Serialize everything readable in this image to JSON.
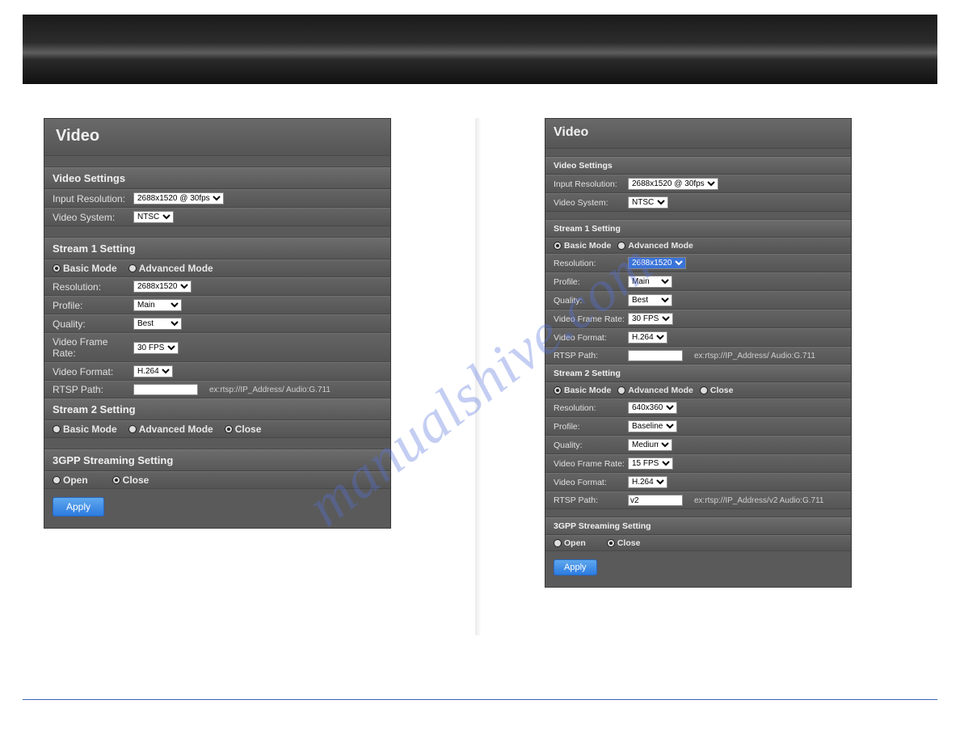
{
  "watermark": "manualshive.com",
  "left": {
    "title": "Video",
    "video_settings": {
      "header": "Video Settings",
      "input_res_label": "Input Resolution:",
      "input_res_value": "2688x1520 @ 30fps",
      "video_system_label": "Video System:",
      "video_system_value": "NTSC"
    },
    "stream1": {
      "header": "Stream 1 Setting",
      "mode_basic": "Basic Mode",
      "mode_advanced": "Advanced Mode",
      "resolution_label": "Resolution:",
      "resolution_value": "2688x1520",
      "profile_label": "Profile:",
      "profile_value": "Main",
      "quality_label": "Quality:",
      "quality_value": "Best",
      "fps_label": "Video Frame Rate:",
      "fps_value": "30 FPS",
      "format_label": "Video Format:",
      "format_value": "H.264",
      "rtsp_label": "RTSP Path:",
      "rtsp_value": "",
      "rtsp_hint": "ex:rtsp://IP_Address/   Audio:G.711"
    },
    "stream2": {
      "header": "Stream 2 Setting",
      "mode_basic": "Basic Mode",
      "mode_advanced": "Advanced Mode",
      "mode_close": "Close"
    },
    "gpp": {
      "header": "3GPP Streaming Setting",
      "open": "Open",
      "close": "Close"
    },
    "apply": "Apply"
  },
  "right": {
    "title": "Video",
    "video_settings": {
      "header": "Video Settings",
      "input_res_label": "Input Resolution:",
      "input_res_value": "2688x1520 @ 30fps",
      "video_system_label": "Video System:",
      "video_system_value": "NTSC"
    },
    "stream1": {
      "header": "Stream 1 Setting",
      "mode_basic": "Basic Mode",
      "mode_advanced": "Advanced Mode",
      "resolution_label": "Resolution:",
      "resolution_value": "2688x1520",
      "profile_label": "Profile:",
      "profile_value": "Main",
      "quality_label": "Quality:",
      "quality_value": "Best",
      "fps_label": "Video Frame Rate:",
      "fps_value": "30 FPS",
      "format_label": "Video Format:",
      "format_value": "H.264",
      "rtsp_label": "RTSP Path:",
      "rtsp_value": "",
      "rtsp_hint": "ex:rtsp://IP_Address/   Audio:G.711"
    },
    "stream2": {
      "header": "Stream 2 Setting",
      "mode_basic": "Basic Mode",
      "mode_advanced": "Advanced Mode",
      "mode_close": "Close",
      "resolution_label": "Resolution:",
      "resolution_value": "640x360",
      "profile_label": "Profile:",
      "profile_value": "Baseline",
      "quality_label": "Quality:",
      "quality_value": "Medium",
      "fps_label": "Video Frame Rate:",
      "fps_value": "15 FPS",
      "format_label": "Video Format:",
      "format_value": "H.264",
      "rtsp_label": "RTSP Path:",
      "rtsp_value": "v2",
      "rtsp_hint": "ex:rtsp://IP_Address/v2   Audio:G.711"
    },
    "gpp": {
      "header": "3GPP Streaming Setting",
      "open": "Open",
      "close": "Close"
    },
    "apply": "Apply"
  }
}
